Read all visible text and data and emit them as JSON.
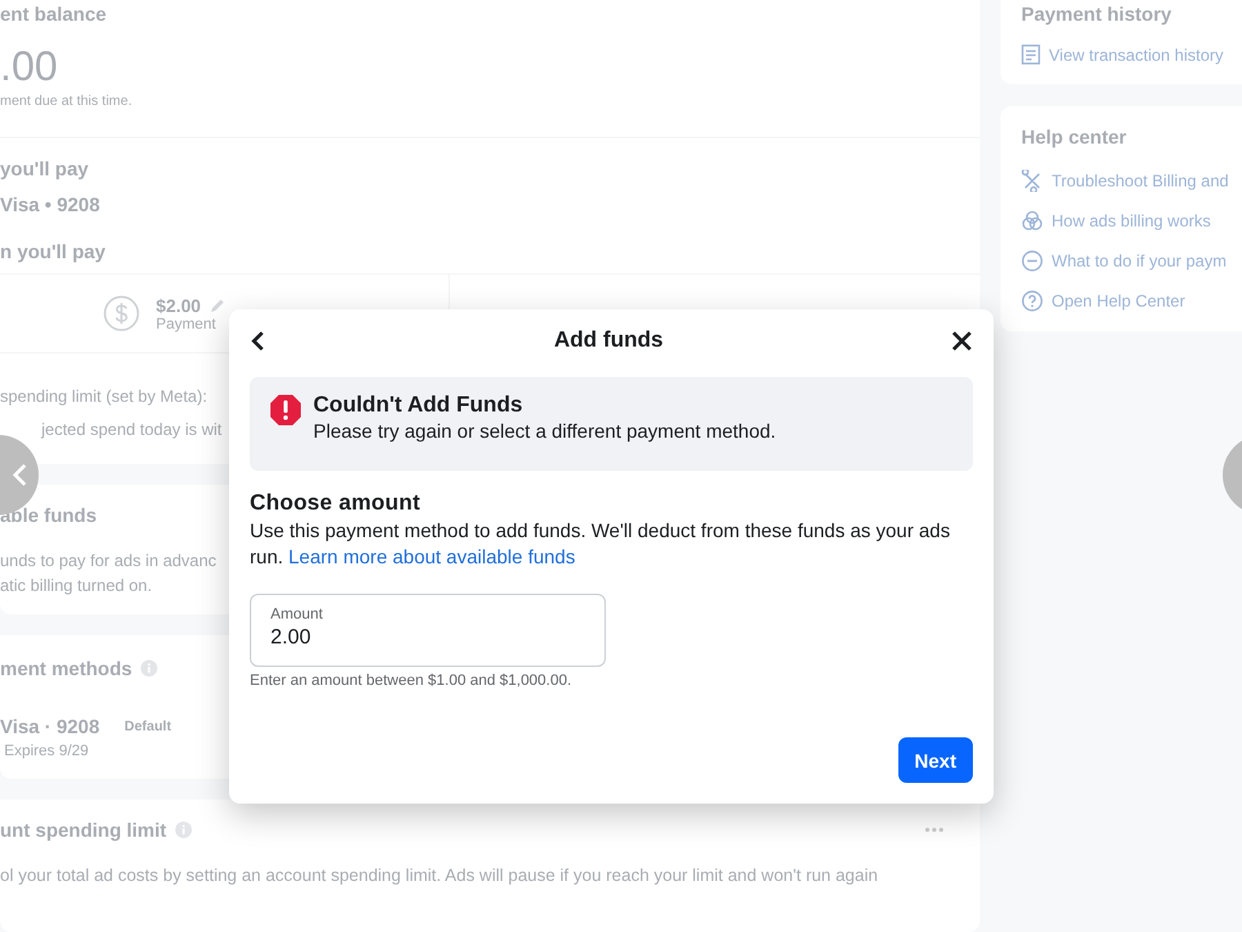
{
  "background": {
    "balance_card": {
      "title": "ent balance",
      "amount": ".00",
      "note": "ment due at this time.",
      "method_label": "you'll pay",
      "method": "Visa • 9208",
      "amount_label": "n you'll pay",
      "payment_amount": "$2.00",
      "payment_caption": "Payment",
      "limit_text": "spending limit (set by Meta):",
      "spend_text": "jected spend today is wit"
    },
    "funds_card": {
      "title": "able funds",
      "lines": [
        "unds to pay for ads in advanc",
        "atic billing turned on."
      ]
    },
    "methods_card": {
      "title": "ment methods",
      "card_name": "Visa · 9208",
      "badge": "Default",
      "expiry": "Expires 9/29"
    },
    "limit_card": {
      "title": "unt spending limit",
      "text": "ol your total ad costs by setting an account spending limit. Ads will pause if you reach your limit and won't run again"
    },
    "payment_history": {
      "title": "Payment history",
      "link": "View transaction history"
    },
    "help_center": {
      "title": "Help center",
      "links": [
        {
          "kind": "tools",
          "label": "Troubleshoot Billing and"
        },
        {
          "kind": "billing",
          "label": "How ads billing works"
        },
        {
          "kind": "minus",
          "label": "What to do if your paym"
        },
        {
          "kind": "question",
          "label": "Open Help Center"
        }
      ]
    }
  },
  "dialog": {
    "title": "Add funds",
    "alert": {
      "title": "Couldn't Add Funds",
      "message": "Please try again or select a different payment method."
    },
    "section_title": "Choose amount",
    "description": "Use this payment method to add funds. We'll deduct from these funds as your ads run.",
    "link": "Learn more about available funds",
    "amount_field": {
      "label": "Amount",
      "value": "2.00"
    },
    "hint": "Enter an amount between $1.00 and $1,000.00.",
    "button": "Next"
  }
}
